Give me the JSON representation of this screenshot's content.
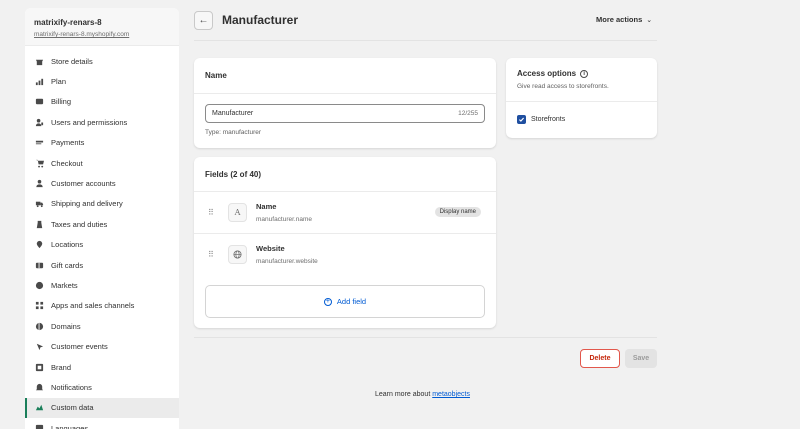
{
  "sidebar": {
    "store_name": "matrixify-renars-8",
    "store_url": "matrixify-renars-8.myshopify.com",
    "items": [
      {
        "label": "Store details",
        "icon": "store-icon"
      },
      {
        "label": "Plan",
        "icon": "plan-icon"
      },
      {
        "label": "Billing",
        "icon": "billing-icon"
      },
      {
        "label": "Users and permissions",
        "icon": "users-icon"
      },
      {
        "label": "Payments",
        "icon": "payments-icon"
      },
      {
        "label": "Checkout",
        "icon": "cart-icon"
      },
      {
        "label": "Customer accounts",
        "icon": "person-icon"
      },
      {
        "label": "Shipping and delivery",
        "icon": "truck-icon"
      },
      {
        "label": "Taxes and duties",
        "icon": "tax-icon"
      },
      {
        "label": "Locations",
        "icon": "location-icon"
      },
      {
        "label": "Gift cards",
        "icon": "gift-card-icon"
      },
      {
        "label": "Markets",
        "icon": "globe-icon"
      },
      {
        "label": "Apps and sales channels",
        "icon": "apps-icon"
      },
      {
        "label": "Domains",
        "icon": "domains-icon"
      },
      {
        "label": "Customer events",
        "icon": "events-icon"
      },
      {
        "label": "Brand",
        "icon": "brand-icon"
      },
      {
        "label": "Notifications",
        "icon": "bell-icon"
      },
      {
        "label": "Custom data",
        "icon": "custom-data-icon",
        "active": true
      },
      {
        "label": "Languages",
        "icon": "languages-icon"
      }
    ]
  },
  "header": {
    "back_glyph": "←",
    "title": "Manufacturer",
    "more_actions": "More actions"
  },
  "name_card": {
    "title": "Name",
    "input_value": "Manufacturer",
    "char_count": "12/255",
    "type_label": "Type:",
    "type_value": "manufacturer"
  },
  "fields_card": {
    "title": "Fields (2 of 40)",
    "fields": [
      {
        "name": "Name",
        "key": "manufacturer.name",
        "icon_glyph": "A",
        "icon": "text-type-icon",
        "badge": "Display name"
      },
      {
        "name": "Website",
        "key": "manufacturer.website",
        "icon_glyph": "",
        "icon": "globe-icon",
        "badge": ""
      }
    ],
    "add_field": "Add field"
  },
  "access_card": {
    "title": "Access options",
    "subtitle": "Give read access to storefronts.",
    "checkbox_label": "Storefronts",
    "checkbox_checked": true
  },
  "actions": {
    "delete": "Delete",
    "save": "Save"
  },
  "footer": {
    "learn_prefix": "Learn more about",
    "learn_link": "metaobjects"
  },
  "colors": {
    "accent": "#005bd3",
    "active_green": "#1a7f5a",
    "danger": "#c5280c",
    "background": "#f1f1f1"
  }
}
